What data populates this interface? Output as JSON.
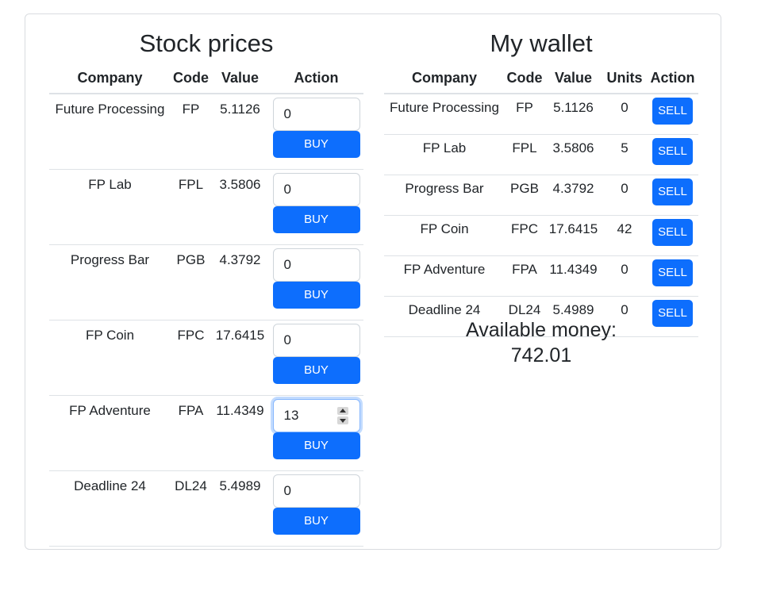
{
  "stock_prices": {
    "title": "Stock prices",
    "columns": [
      "Company",
      "Code",
      "Value",
      "Action"
    ],
    "rows": [
      {
        "company": "Future Processing",
        "code": "FP",
        "value": "5.1126",
        "qty": "0",
        "button": "BUY"
      },
      {
        "company": "FP Lab",
        "code": "FPL",
        "value": "3.5806",
        "qty": "0",
        "button": "BUY"
      },
      {
        "company": "Progress Bar",
        "code": "PGB",
        "value": "4.3792",
        "qty": "0",
        "button": "BUY"
      },
      {
        "company": "FP Coin",
        "code": "FPC",
        "value": "17.6415",
        "qty": "0",
        "button": "BUY"
      },
      {
        "company": "FP Adventure",
        "code": "FPA",
        "value": "11.4349",
        "qty": "13",
        "button": "BUY"
      },
      {
        "company": "Deadline 24",
        "code": "DL24",
        "value": "5.4989",
        "qty": "0",
        "button": "BUY"
      }
    ]
  },
  "wallet": {
    "title": "My wallet",
    "columns": [
      "Company",
      "Code",
      "Value",
      "Units",
      "Action"
    ],
    "rows": [
      {
        "company": "Future Processing",
        "code": "FP",
        "value": "5.1126",
        "units": "0",
        "button": "SELL"
      },
      {
        "company": "FP Lab",
        "code": "FPL",
        "value": "3.5806",
        "units": "5",
        "button": "SELL"
      },
      {
        "company": "Progress Bar",
        "code": "PGB",
        "value": "4.3792",
        "units": "0",
        "button": "SELL"
      },
      {
        "company": "FP Coin",
        "code": "FPC",
        "value": "17.6415",
        "units": "42",
        "button": "SELL"
      },
      {
        "company": "FP Adventure",
        "code": "FPA",
        "value": "11.4349",
        "units": "0",
        "button": "SELL"
      },
      {
        "company": "Deadline 24",
        "code": "DL24",
        "value": "5.4989",
        "units": "0",
        "button": "SELL"
      }
    ]
  },
  "available_money": {
    "label": "Available money:",
    "value": "742.01"
  },
  "colors": {
    "primary_button": "#0d6efd",
    "focus_border": "#86b7fe",
    "table_border": "#dee2e6"
  }
}
